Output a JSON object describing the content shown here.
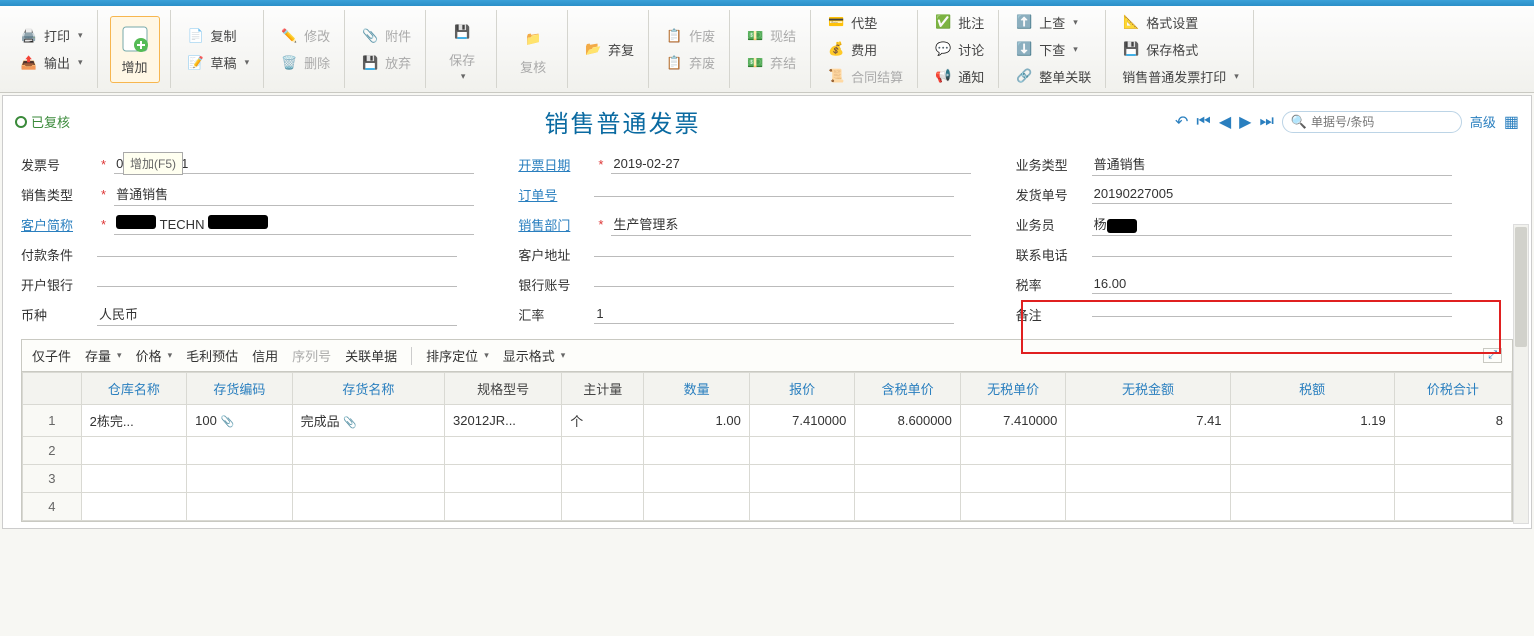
{
  "toolbar": {
    "print": "打印",
    "export": "输出",
    "add": "增加",
    "add_tooltip": "增加(F5)",
    "copy": "复制",
    "draft": "草稿",
    "modify": "修改",
    "delete": "删除",
    "attachment": "附件",
    "abandon_save": "放弃",
    "save": "保存",
    "review": "复核",
    "recover": "弃复",
    "void": "作废",
    "discard": "弃废",
    "cash": "现结",
    "abandon2": "弃结",
    "advance": "代垫",
    "expense": "费用",
    "contract": "合同结算",
    "approve": "批注",
    "discuss": "讨论",
    "notify": "通知",
    "up_search": "上查",
    "down_search": "下查",
    "whole_link": "整单关联",
    "format_set": "格式设置",
    "save_format": "保存格式",
    "invoice_print": "销售普通发票打印"
  },
  "doc": {
    "status": "已复核",
    "title": "销售普通发票",
    "search_placeholder": "单据号/条码",
    "advanced": "高级"
  },
  "form": {
    "invoice_no_label": "发票号",
    "invoice_no": "0000000001",
    "invoice_date_label": "开票日期",
    "invoice_date": "2019-02-27",
    "biz_type_label": "业务类型",
    "biz_type": "普通销售",
    "sale_type_label": "销售类型",
    "sale_type": "普通销售",
    "order_no_label": "订单号",
    "order_no": "",
    "delivery_no_label": "发货单号",
    "delivery_no": "20190227005",
    "customer_label": "客户简称",
    "customer": "",
    "sales_dept_label": "销售部门",
    "sales_dept": "生产管理系",
    "salesman_label": "业务员",
    "salesman": "杨",
    "pay_terms_label": "付款条件",
    "cust_addr_label": "客户地址",
    "contact_label": "联系电话",
    "bank_label": "开户银行",
    "account_no_label": "银行账号",
    "tax_rate_label": "税率",
    "tax_rate": "16.00",
    "currency_label": "币种",
    "currency": "人民币",
    "exchange_label": "汇率",
    "exchange": "1",
    "remark_label": "备注"
  },
  "grid_toolbar": {
    "only_sub": "仅子件",
    "stock": "存量",
    "price": "价格",
    "profit": "毛利预估",
    "credit": "信用",
    "serial": "序列号",
    "related": "关联单据",
    "sort": "排序定位",
    "display": "显示格式"
  },
  "grid": {
    "headers": {
      "warehouse": "仓库名称",
      "inv_code": "存货编码",
      "inv_name": "存货名称",
      "spec": "规格型号",
      "main_unit": "主计量",
      "qty": "数量",
      "quote": "报价",
      "tax_price": "含税单价",
      "notax_price": "无税单价",
      "notax_amount": "无税金额",
      "tax_amount": "税额",
      "total_amount": "价税合计"
    },
    "rows": [
      {
        "idx": "1",
        "warehouse": "2栋完...",
        "inv_code": "100",
        "inv_name": "完成品",
        "spec": "32012JR...",
        "main_unit": "个",
        "qty": "1.00",
        "quote": "7.410000",
        "tax_price": "8.600000",
        "notax_price": "7.410000",
        "notax_amount": "7.41",
        "tax_amount": "1.19",
        "total_amount": "8"
      },
      {
        "idx": "2"
      },
      {
        "idx": "3"
      },
      {
        "idx": "4"
      }
    ]
  }
}
